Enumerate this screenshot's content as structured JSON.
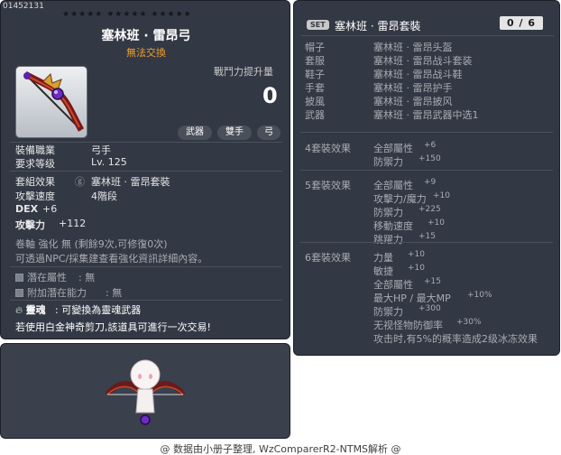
{
  "item": {
    "id": "01452131",
    "stars": "★★★★★ ★★★★★ ★★★★★",
    "name": "塞林班 · 雷昂弓",
    "trade": "無法交換",
    "power_label": "戰鬥力提升量",
    "power_value": "0",
    "categories": [
      "武器",
      "雙手",
      "弓"
    ],
    "req_job_label": "裝備職業",
    "req_job_value": "弓手",
    "req_level_label": "要求等级",
    "req_level_value": "Lv. 125",
    "set_label": "套組效果",
    "set_value": "塞林班 · 雷昂套裝",
    "speed_label": "攻擊速度",
    "speed_value": "4階段",
    "dex_label": "DEX",
    "dex_value": "+6",
    "atk_label": "攻擊力",
    "atk_value": "+112",
    "scroll_line": "卷軸 強化 無 (剩餘9次,可修復0次)",
    "npc_line": "可透過NPC/採集建查看強化資訊詳細內容。",
    "potential_label": "潛在屬性",
    "potential_value": ": 無",
    "addpotential_label": "附加潛在能力",
    "addpotential_value": ": 無",
    "soul_label": "靈魂",
    "soul_value": ": 可變換為靈魂武器",
    "scissors_line": "若使用白金神奇剪刀,該道具可進行一次交易!"
  },
  "set": {
    "badge": "SET",
    "name": "塞林班 · 雷昂套裝",
    "counter": "0 / 6",
    "pieces": [
      {
        "slot": "帽子",
        "name": "塞林班 · 雷昂头盔"
      },
      {
        "slot": "套服",
        "name": "塞林班 · 雷昂战斗套装"
      },
      {
        "slot": "鞋子",
        "name": "塞林班 · 雷昂战斗鞋"
      },
      {
        "slot": "手套",
        "name": "塞林班 · 雷昂护手"
      },
      {
        "slot": "披風",
        "name": "塞林班 · 雷昂披风"
      },
      {
        "slot": "武器",
        "name": "塞林班 · 雷昂武器中选1"
      }
    ],
    "effects": [
      {
        "title": "4套裝效果",
        "lines": [
          [
            "全部屬性",
            "+6"
          ],
          [
            "防禦力",
            "+150"
          ]
        ]
      },
      {
        "title": "5套裝效果",
        "lines": [
          [
            "全部屬性",
            "+9"
          ],
          [
            "攻擊力/魔力",
            "+10"
          ],
          [
            "防禦力",
            "+225"
          ],
          [
            "移動速度",
            "+10"
          ],
          [
            "跳躍力",
            "+15"
          ]
        ]
      },
      {
        "title": "6套裝效果",
        "lines": [
          [
            "力量",
            "+10"
          ],
          [
            "敏捷",
            "+10"
          ],
          [
            "全部屬性",
            "+15"
          ],
          [
            "最大HP / 最大MP",
            "+10%"
          ],
          [
            "防禦力",
            "+300"
          ],
          [
            "无视怪物防御率",
            "+30%"
          ],
          [
            "攻击时,有5%的概率造成2级冰冻效果",
            ""
          ]
        ]
      }
    ]
  },
  "credit": "@ 数据由小册子整理, WzComparerR2-NTMS解析 @",
  "colors": {
    "panel": "#323844",
    "trade": "#f0a030",
    "counter_bg": "#e4e4e4"
  }
}
